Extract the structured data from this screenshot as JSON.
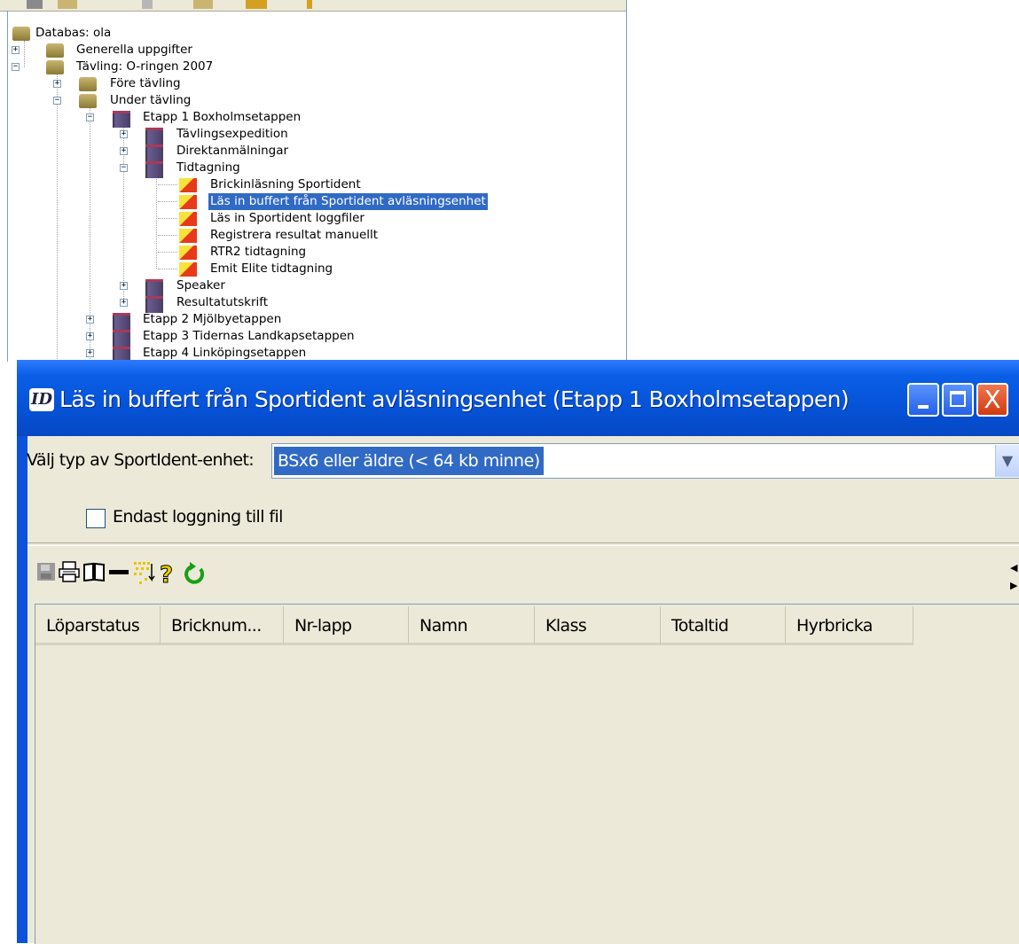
{
  "tree": {
    "nodes": [
      {
        "label": "Databas: ola",
        "icon": "database-icon",
        "expand": ""
      },
      {
        "label": "Generella uppgifter",
        "icon": "database-icon",
        "expand": "+"
      },
      {
        "label": "Tävling: O-ringen 2007",
        "icon": "database-icon",
        "expand": "−"
      },
      {
        "label": "Före tävling",
        "icon": "stack-icon",
        "expand": "+"
      },
      {
        "label": "Under tävling",
        "icon": "stack-icon",
        "expand": "−"
      },
      {
        "label": "Etapp 1 Boxholmsetappen",
        "icon": "folder-icon",
        "expand": "−"
      },
      {
        "label": "Tävlingsexpedition",
        "icon": "folder-icon",
        "expand": "+"
      },
      {
        "label": "Direktanmälningar",
        "icon": "folder-icon",
        "expand": "+"
      },
      {
        "label": "Tidtagning",
        "icon": "folder-icon",
        "expand": "−"
      },
      {
        "label": "Brickinläsning Sportident",
        "icon": "module-icon",
        "expand": ""
      },
      {
        "label": "Läs in buffert från Sportident avläsningsenhet",
        "icon": "module-icon",
        "expand": "",
        "selected": true
      },
      {
        "label": "Läs in Sportident loggfiler",
        "icon": "module-icon",
        "expand": ""
      },
      {
        "label": "Registrera resultat manuellt",
        "icon": "module-icon",
        "expand": ""
      },
      {
        "label": "RTR2 tidtagning",
        "icon": "module-icon",
        "expand": ""
      },
      {
        "label": "Emit Elite tidtagning",
        "icon": "module-icon",
        "expand": ""
      },
      {
        "label": "Speaker",
        "icon": "folder-icon",
        "expand": "+"
      },
      {
        "label": "Resultatutskrift",
        "icon": "folder-icon",
        "expand": "+"
      },
      {
        "label": "Etapp 2 Mjölbyetappen",
        "icon": "folder-icon",
        "expand": "+"
      },
      {
        "label": "Etapp 3 Tidernas Landkapsetappen",
        "icon": "folder-icon",
        "expand": "+"
      },
      {
        "label": "Etapp 4 Linköpingsetappen",
        "icon": "folder-icon",
        "expand": "+"
      }
    ]
  },
  "dialog": {
    "title": "Läs in buffert från Sportident avläsningsenhet (Etapp 1 Boxholmsetappen)",
    "app_icon_text": "ID",
    "unit_type_label": "Välj typ av SportIdent-enhet:",
    "unit_type_value": "BSx6 eller äldre (< 64 kb minne)",
    "log_only_label": "Endast loggning till fil",
    "log_only_checked": false,
    "toolbar_icons": [
      "save-disabled-icon",
      "print-icon",
      "book-icon",
      "minus-icon",
      "sort-icon",
      "help-icon",
      "refresh-icon"
    ],
    "columns": [
      "Löparstatus",
      "Bricknum...",
      "Nr-lapp",
      "Namn",
      "Klass",
      "Totaltid",
      "Hyrbricka"
    ]
  },
  "colors": {
    "titlebar": "#0553d8",
    "selection": "#316ac5",
    "client_bg": "#ece9d8",
    "close_button": "#d13a10"
  }
}
